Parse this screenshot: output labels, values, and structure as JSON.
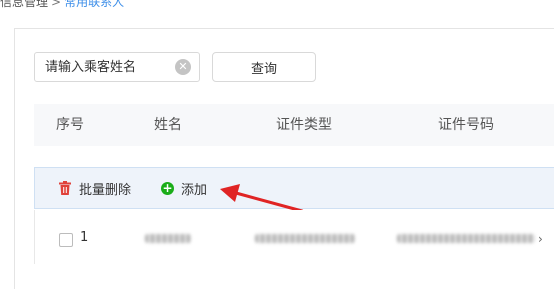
{
  "breadcrumb": {
    "parent": "信息管理",
    "separator": ">",
    "current": "常用联系人"
  },
  "search": {
    "placeholder": "请输入乘客姓名",
    "query_button": "查询"
  },
  "table": {
    "columns": [
      "序号",
      "姓名",
      "证件类型",
      "证件号码"
    ]
  },
  "toolbar": {
    "batch_delete_label": "批量删除",
    "add_label": "添加"
  },
  "rows": [
    {
      "index": "1"
    }
  ],
  "colors": {
    "accent_link": "#3d8ee8",
    "delete_icon": "#e0413a",
    "add_icon": "#1aad19",
    "annotation_arrow": "#e02424"
  }
}
